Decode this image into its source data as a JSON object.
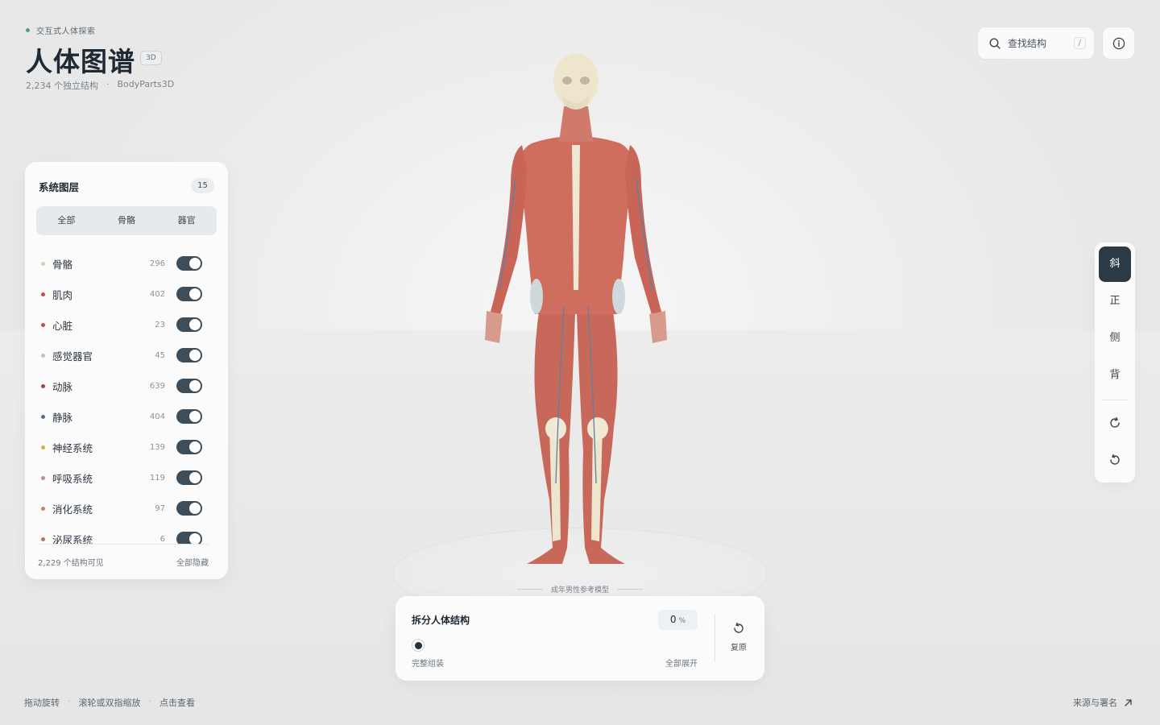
{
  "header": {
    "eyebrow": "交互式人体探索",
    "title": "人体图谱",
    "badge": "3D",
    "stats": "2,234 个独立结构",
    "separator": "·",
    "source": "BodyParts3D"
  },
  "search": {
    "label": "查找结构",
    "shortcut": "/"
  },
  "layers_panel": {
    "title": "系统图层",
    "count": "15",
    "filters": [
      "全部",
      "骨骼",
      "器官"
    ],
    "items": [
      {
        "name": "骨骼",
        "count": "296",
        "color": "#d9d3b4",
        "on": true
      },
      {
        "name": "肌肉",
        "count": "402",
        "color": "#b5544c",
        "on": true
      },
      {
        "name": "心脏",
        "count": "23",
        "color": "#b5544c",
        "on": true
      },
      {
        "name": "感觉器官",
        "count": "45",
        "color": "#a9c5cf",
        "on": true
      },
      {
        "name": "动脉",
        "count": "639",
        "color": "#a8433c",
        "on": true
      },
      {
        "name": "静脉",
        "count": "404",
        "color": "#4f6f9b",
        "on": true
      },
      {
        "name": "神经系统",
        "count": "139",
        "color": "#d4b04c",
        "on": true
      },
      {
        "name": "呼吸系统",
        "count": "119",
        "color": "#c28b92",
        "on": true
      },
      {
        "name": "消化系统",
        "count": "97",
        "color": "#c58266",
        "on": true
      },
      {
        "name": "泌尿系统",
        "count": "6",
        "color": "#b0775f",
        "on": true
      }
    ],
    "visible_text": "2,229 个结构可见",
    "hide_all": "全部隐藏"
  },
  "views": {
    "items": [
      "斜",
      "正",
      "侧",
      "背"
    ],
    "active": "斜"
  },
  "model_label": "成年男性参考模型",
  "explode": {
    "title": "拆分人体结构",
    "value": "0",
    "unit": "%",
    "min_label": "完整组装",
    "max_label": "全部展开",
    "reset_label": "复原"
  },
  "footer": {
    "hints": [
      "拖动旋转",
      "滚轮或双指缩放",
      "点击查看"
    ],
    "hint_sep": "·",
    "credits": "来源与署名"
  }
}
